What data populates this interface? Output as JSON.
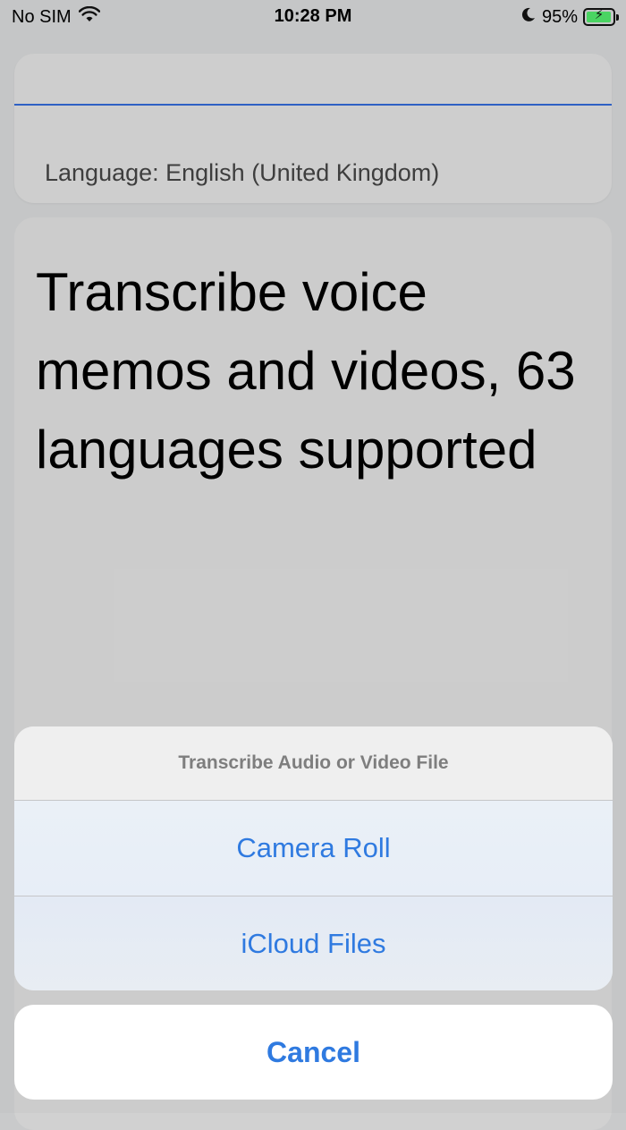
{
  "status_bar": {
    "carrier": "No SIM",
    "time": "10:28 PM",
    "battery_percent": "95%",
    "battery_level": 0.95,
    "battery_color": "#4cd964",
    "icons": [
      "wifi-icon",
      "moon-icon",
      "battery-charging-icon"
    ]
  },
  "language_card": {
    "label": "Language: English (United Kingdom)",
    "underline_color": "#2f62c8"
  },
  "main": {
    "headline": "Transcribe voice memos and videos, 63 languages supported"
  },
  "action_sheet": {
    "title": "Transcribe Audio or Video File",
    "options": [
      "Camera Roll",
      "iCloud Files"
    ],
    "cancel_label": "Cancel",
    "accent_color": "#2f7ae0"
  }
}
